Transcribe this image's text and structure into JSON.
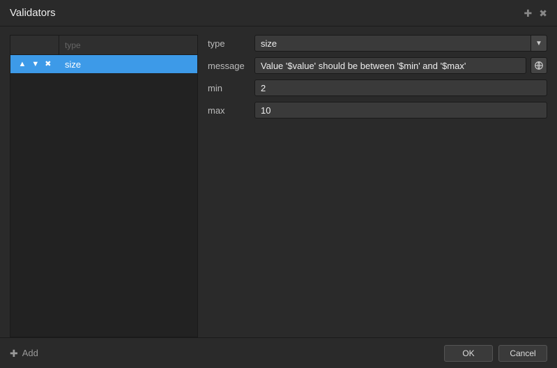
{
  "title": "Validators",
  "table": {
    "header_type": "type",
    "rows": [
      {
        "type": "size",
        "selected": true
      }
    ]
  },
  "form": {
    "type": {
      "label": "type",
      "value": "size"
    },
    "message": {
      "label": "message",
      "value": "Value '$value' should be between '$min' and '$max'"
    },
    "min": {
      "label": "min",
      "value": "2"
    },
    "max": {
      "label": "max",
      "value": "10"
    }
  },
  "footer": {
    "add": "Add",
    "ok": "OK",
    "cancel": "Cancel"
  }
}
